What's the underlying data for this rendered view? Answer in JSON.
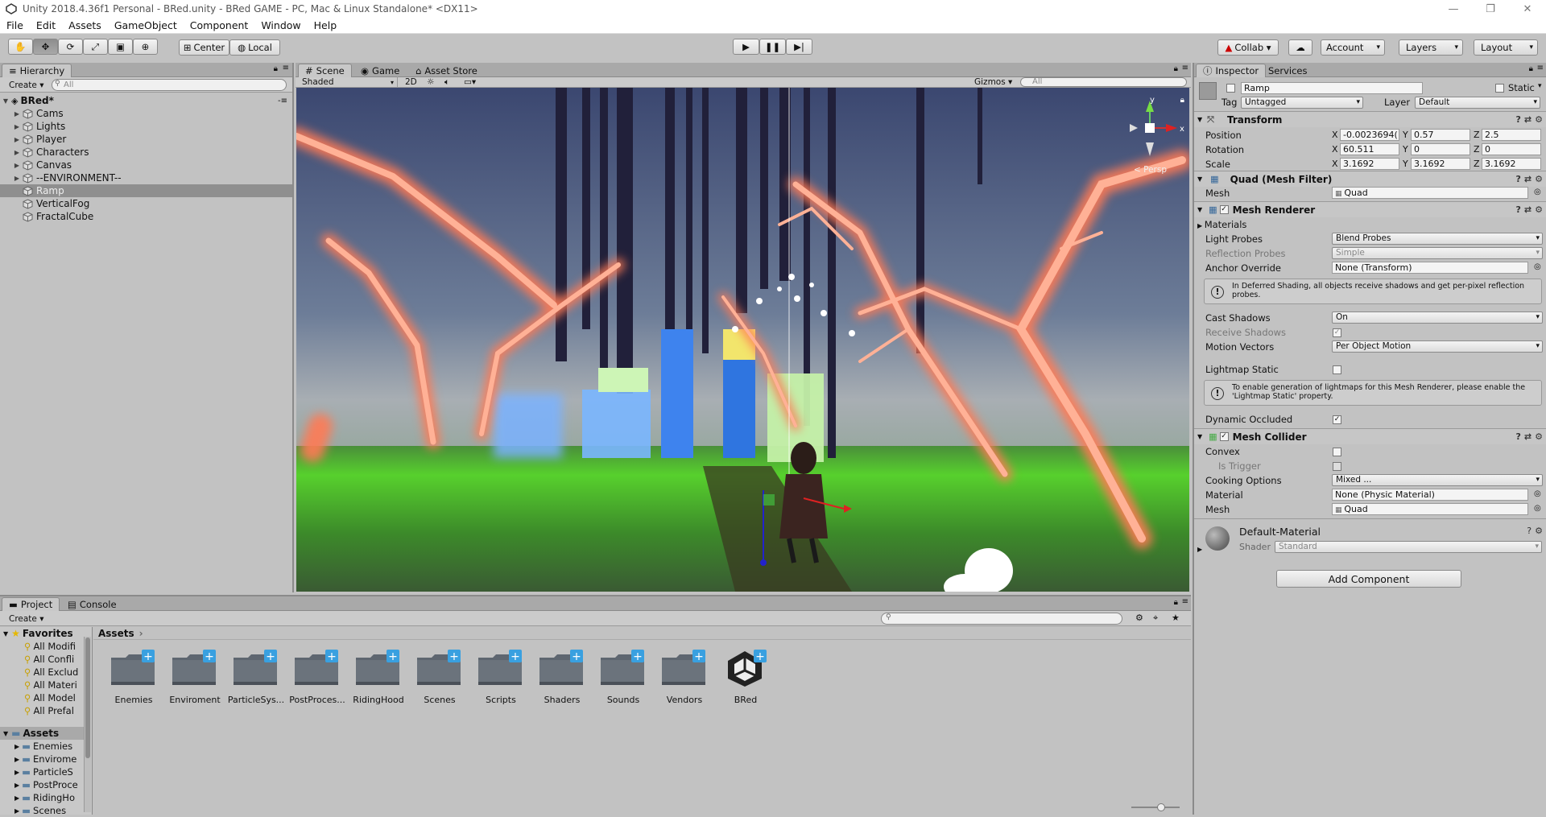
{
  "window": {
    "title": "Unity 2018.4.36f1 Personal - BRed.unity - BRed GAME - PC, Mac & Linux Standalone* <DX11>",
    "controls": [
      "—",
      "❐",
      "✕"
    ]
  },
  "menu": [
    "File",
    "Edit",
    "Assets",
    "GameObject",
    "Component",
    "Window",
    "Help"
  ],
  "toolbar": {
    "pivot": "Center",
    "space": "Local",
    "collab": "Collab ▾",
    "account": "Account",
    "layers": "Layers",
    "layout": "Layout"
  },
  "hierarchy": {
    "tab": "Hierarchy",
    "create": "Create ▾",
    "search_placeholder": "All",
    "scene": "BRed*",
    "items": [
      {
        "label": "Cams",
        "expandable": true
      },
      {
        "label": "Lights",
        "expandable": true
      },
      {
        "label": "Player",
        "expandable": true
      },
      {
        "label": "Characters",
        "expandable": true
      },
      {
        "label": "Canvas",
        "expandable": true
      },
      {
        "label": "--ENVIRONMENT--",
        "expandable": true
      },
      {
        "label": "Ramp",
        "expandable": false,
        "selected": true
      },
      {
        "label": "VerticalFog",
        "expandable": false
      },
      {
        "label": "FractalCube",
        "expandable": false
      }
    ]
  },
  "scene_view": {
    "tabs": [
      "Scene",
      "Game",
      "Asset Store"
    ],
    "shading": "Shaded",
    "mode_2d": "2D",
    "gizmos": "Gizmos ▾",
    "search_placeholder": "All",
    "persp": "< Persp",
    "axis": {
      "y": "y",
      "x": "x"
    }
  },
  "inspector": {
    "tabs": [
      "Inspector",
      "Services"
    ],
    "object_name": "Ramp",
    "static_label": "Static",
    "tag_label": "Tag",
    "tag": "Untagged",
    "layer_label": "Layer",
    "layer": "Default",
    "transform": {
      "title": "Transform",
      "position_label": "Position",
      "rotation_label": "Rotation",
      "scale_label": "Scale",
      "position": [
        "-0.0023694(",
        "0.57",
        "2.5"
      ],
      "rotation": [
        "60.511",
        "0",
        "0"
      ],
      "scale": [
        "3.1692",
        "3.1692",
        "3.1692"
      ],
      "axes": [
        "X",
        "Y",
        "Z"
      ]
    },
    "mesh_filter": {
      "title": "Quad (Mesh Filter)",
      "mesh_label": "Mesh",
      "mesh": "Quad"
    },
    "mesh_renderer": {
      "title": "Mesh Renderer",
      "materials": "Materials",
      "light_probes_label": "Light Probes",
      "light_probes": "Blend Probes",
      "reflection_probes_label": "Reflection Probes",
      "reflection_probes": "Simple",
      "anchor_override_label": "Anchor Override",
      "anchor_override": "None (Transform)",
      "deferred_help": "In Deferred Shading, all objects receive shadows and get per-pixel reflection probes.",
      "cast_shadows_label": "Cast Shadows",
      "cast_shadows": "On",
      "receive_shadows_label": "Receive Shadows",
      "motion_vectors_label": "Motion Vectors",
      "motion_vectors": "Per Object Motion",
      "lightmap_static_label": "Lightmap Static",
      "lightmap_help": "To enable generation of lightmaps for this Mesh Renderer, please enable the 'Lightmap Static' property.",
      "dynamic_occluded_label": "Dynamic Occluded"
    },
    "mesh_collider": {
      "title": "Mesh Collider",
      "convex_label": "Convex",
      "is_trigger_label": "Is Trigger",
      "cooking_label": "Cooking Options",
      "cooking": "Mixed ...",
      "material_label": "Material",
      "material": "None (Physic Material)",
      "mesh_label": "Mesh",
      "mesh": "Quad"
    },
    "material": {
      "name": "Default-Material",
      "shader_label": "Shader",
      "shader": "Standard"
    },
    "add_component": "Add Component"
  },
  "project": {
    "tabs": [
      "Project",
      "Console"
    ],
    "create": "Create ▾",
    "favorites_label": "Favorites",
    "favorites": [
      "All Modifi",
      "All Confli",
      "All Exclud",
      "All Materi",
      "All Model",
      "All Prefal"
    ],
    "assets_label": "Assets",
    "asset_tree": [
      "Enemies",
      "Envirome",
      "ParticleS",
      "PostProce",
      "RidingHo",
      "Scenes"
    ],
    "breadcrumb": "Assets",
    "folders": [
      "Enemies",
      "Enviroment",
      "ParticleSys...",
      "PostProces...",
      "RidingHood",
      "Scenes",
      "Scripts",
      "Shaders",
      "Sounds",
      "Vendors",
      "BRed"
    ]
  }
}
